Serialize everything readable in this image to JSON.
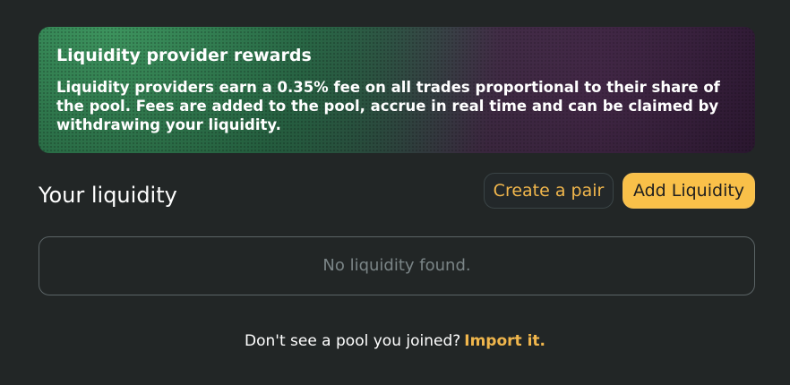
{
  "banner": {
    "title": "Liquidity provider rewards",
    "text": "Liquidity providers earn a 0.35% fee on all trades proportional to their share of the pool. Fees are added to the pool, accrue in real time and can be claimed by withdrawing your liquidity."
  },
  "section": {
    "title": "Your liquidity",
    "create_pair_label": "Create a pair",
    "add_liquidity_label": "Add Liquidity"
  },
  "empty_state": {
    "text": "No liquidity found."
  },
  "footer": {
    "prompt": "Don't see a pool you joined?",
    "import_label": "Import it."
  },
  "colors": {
    "background": "#222626",
    "accent": "#F9C049",
    "link": "#F0B64C"
  }
}
